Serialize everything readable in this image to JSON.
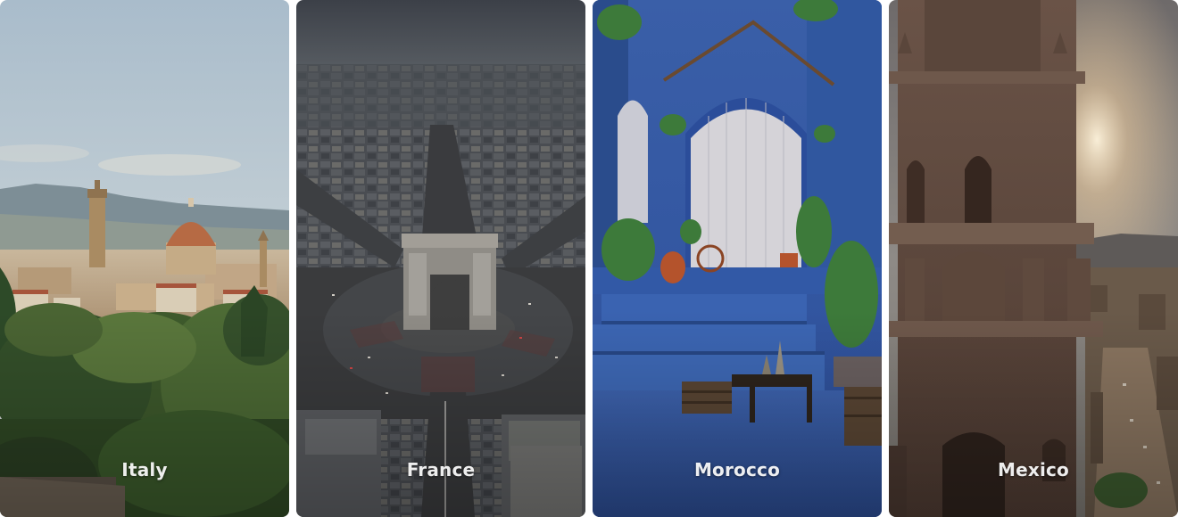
{
  "gallery": {
    "cards": [
      {
        "label": "Italy"
      },
      {
        "label": "France"
      },
      {
        "label": "Morocco"
      },
      {
        "label": "Mexico"
      }
    ]
  }
}
